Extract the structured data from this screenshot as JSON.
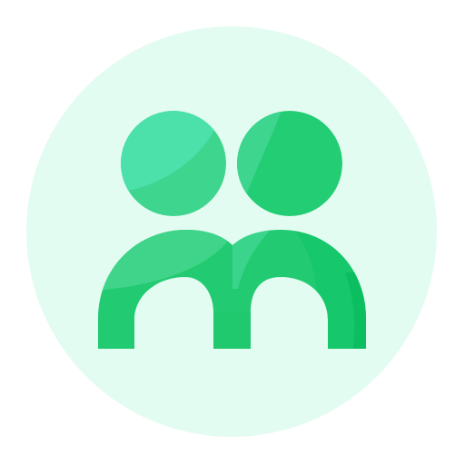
{
  "icon": {
    "name": "people-group-icon",
    "colors": {
      "background_circle": "#E3FCF1",
      "head_left_light": "#4CE0AA",
      "head_left_dark": "#3ED58F",
      "head_right_light": "#3ED58F",
      "head_right_dark": "#22CD74",
      "body_light": "#40D48A",
      "body_mid": "#22CB72",
      "body_dark": "#0FC466"
    }
  }
}
